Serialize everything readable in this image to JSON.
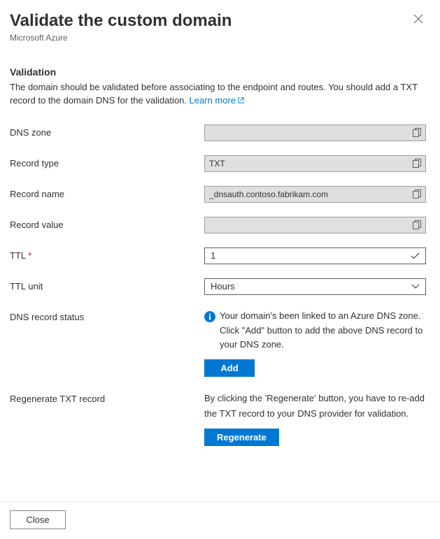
{
  "header": {
    "title": "Validate the custom domain",
    "subtitle": "Microsoft Azure"
  },
  "validation": {
    "heading": "Validation",
    "description": "The domain should be validated before associating to the endpoint and routes. You should add a TXT record to the domain DNS for the validation. ",
    "learn_more": "Learn more"
  },
  "fields": {
    "dns_zone": {
      "label": "DNS zone",
      "value": ""
    },
    "record_type": {
      "label": "Record type",
      "value": "TXT"
    },
    "record_name": {
      "label": "Record name",
      "value": "_dnsauth.contoso.fabrikam.com"
    },
    "record_value": {
      "label": "Record value",
      "value": ""
    },
    "ttl": {
      "label": "TTL",
      "value": "1"
    },
    "ttl_unit": {
      "label": "TTL unit",
      "value": "Hours"
    },
    "dns_record_status": {
      "label": "DNS record status",
      "message": "Your domain's been linked to an Azure DNS zone. Click \"Add\" button to add the above DNS record to your DNS zone.",
      "button": "Add"
    },
    "regenerate": {
      "label": "Regenerate TXT record",
      "message": "By clicking the 'Regenerate' button, you have to re-add the TXT record to your DNS provider for validation.",
      "button": "Regenerate"
    }
  },
  "footer": {
    "close": "Close"
  }
}
